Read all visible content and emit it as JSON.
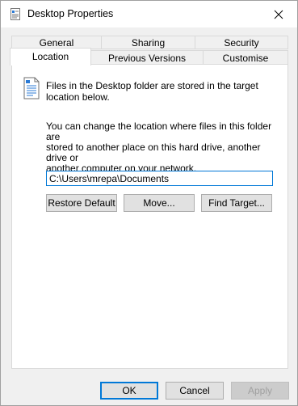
{
  "window": {
    "title": "Desktop Properties"
  },
  "tabs": {
    "row1": [
      "General",
      "Sharing",
      "Security"
    ],
    "row2": [
      "Location",
      "Previous Versions",
      "Customise"
    ]
  },
  "location": {
    "info_line1": "Files in the Desktop folder are stored in the target",
    "info_line2": "location below.",
    "desc_line1": "You can change the location where files in this folder are",
    "desc_line2": "stored to another place on this hard drive, another drive or",
    "desc_line3": "another computer on your network.",
    "path_value": "C:\\Users\\mrepa\\Documents",
    "restore_label": "Restore Default",
    "move_label": "Move...",
    "find_label": "Find Target..."
  },
  "footer": {
    "ok_label": "OK",
    "cancel_label": "Cancel",
    "apply_label": "Apply"
  },
  "icons": {
    "title": "properties-icon",
    "close": "close-icon",
    "folder": "document-icon"
  }
}
